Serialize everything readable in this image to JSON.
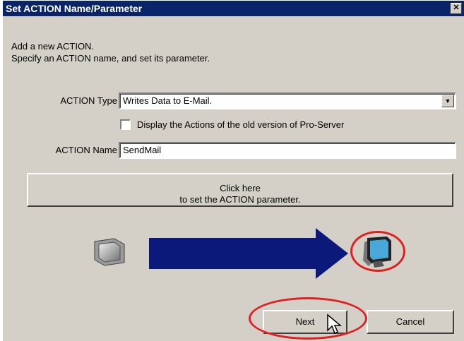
{
  "dialog": {
    "title": "Set ACTION Name/Parameter",
    "close_glyph": "✕",
    "description_line1": "Add a new ACTION.",
    "description_line2": "Specify an ACTION name, and set its parameter."
  },
  "action_type": {
    "label": "ACTION Type",
    "value": "Writes Data to E-Mail."
  },
  "old_version_checkbox": {
    "label": "Display the Actions of the old version of Pro-Server",
    "checked": false
  },
  "action_name": {
    "label": "ACTION Name",
    "value": "SendMail"
  },
  "parameter_button": {
    "line1": "Click here",
    "line2": "to set the ACTION parameter."
  },
  "buttons": {
    "next": "Next",
    "cancel": "Cancel"
  },
  "icons": {
    "source": "display-panel-icon",
    "flow": "right-arrow-icon",
    "target": "pc-monitor-icon",
    "cursor": "mouse-pointer-icon"
  },
  "colors": {
    "titlebar": "#0a246a",
    "arrow": "#0b1a7a",
    "highlight": "#e02020"
  }
}
